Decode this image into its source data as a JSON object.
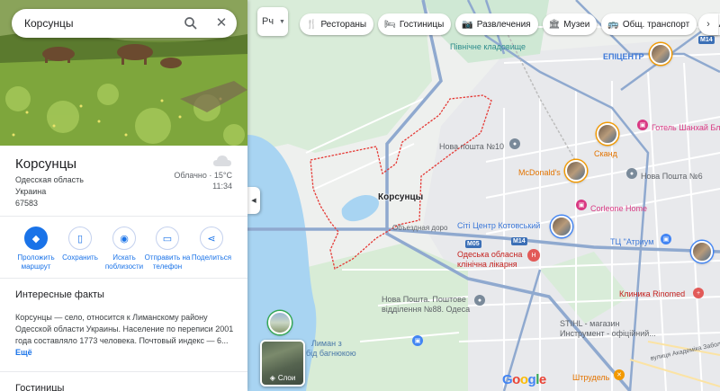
{
  "search": {
    "value": "Корсунцы"
  },
  "place": {
    "title": "Корсунцы",
    "region": "Одесская область",
    "country": "Украина",
    "postcode": "67583",
    "weather": "Облачно · 15°C",
    "time": "11:34"
  },
  "actions": [
    {
      "label": "Проложить маршрут"
    },
    {
      "label": "Сохранить"
    },
    {
      "label": "Искать поблизости"
    },
    {
      "label": "Отправить на телефон"
    },
    {
      "label": "Поделиться"
    }
  ],
  "facts": {
    "title": "Интересные факты",
    "text": "Корсунцы — село, относится к Лиманскому району Одесской области Украины. Население по переписи 2001 года составляло 1773 человека. Почтовый индекс — 6...",
    "more": "Ещё"
  },
  "next_section": {
    "title": "Гостиницы"
  },
  "map_type": {
    "label": "Рч"
  },
  "chips": [
    {
      "label": "Рестораны",
      "icon": "fork-knife-icon"
    },
    {
      "label": "Гостиницы",
      "icon": "bed-icon"
    },
    {
      "label": "Развлечения",
      "icon": "camera-icon"
    },
    {
      "label": "Музеи",
      "icon": "museum-icon"
    },
    {
      "label": "Общ. транспорт",
      "icon": "bus-icon"
    },
    {
      "label": "А",
      "icon": "pharmacy-icon"
    }
  ],
  "layers": {
    "label": "Слои"
  },
  "map_labels": {
    "cemetery": "Північне кладовище",
    "epicenter": "ЕПІЦЕНТР",
    "hotel": "Готель Шанхай Бл",
    "skand": "Сканд",
    "nova_poshta_10": "Нова пошта №10",
    "mcdonalds": "McDonald's",
    "nova_poshta_other": "Нова Пошта №6",
    "corleone": "Corleone Home",
    "town": "Корсунцы",
    "city_center": "Сіті Центр Котовський",
    "atrium": "ТЦ \"Атриум",
    "road_label": "Объездная доро",
    "hospital_1": "Одеська обласна",
    "hospital_2": "клінічна лікарня",
    "ring_clinic": "Клиника Rinomed",
    "np88_1": "Нова Пошта. Поштове",
    "np88_2": "відділення №88. Одеса",
    "stihl_1": "STIHL - магазин",
    "stihl_2": "Инструмент - офіційний...",
    "liman_1": "Лиман з",
    "liman_2": "бiд багнюкою",
    "street_acad": "вулиця Академіка Заболотного",
    "shtrudel": "Штрудель",
    "m05": "M05",
    "m14": "M14",
    "m14b": "M14",
    "google": "Google"
  },
  "colors": {
    "accent": "#1a73e8",
    "water": "#a8d4f2",
    "boundary": "#e53935",
    "road_blue": "#8fa9cf"
  }
}
